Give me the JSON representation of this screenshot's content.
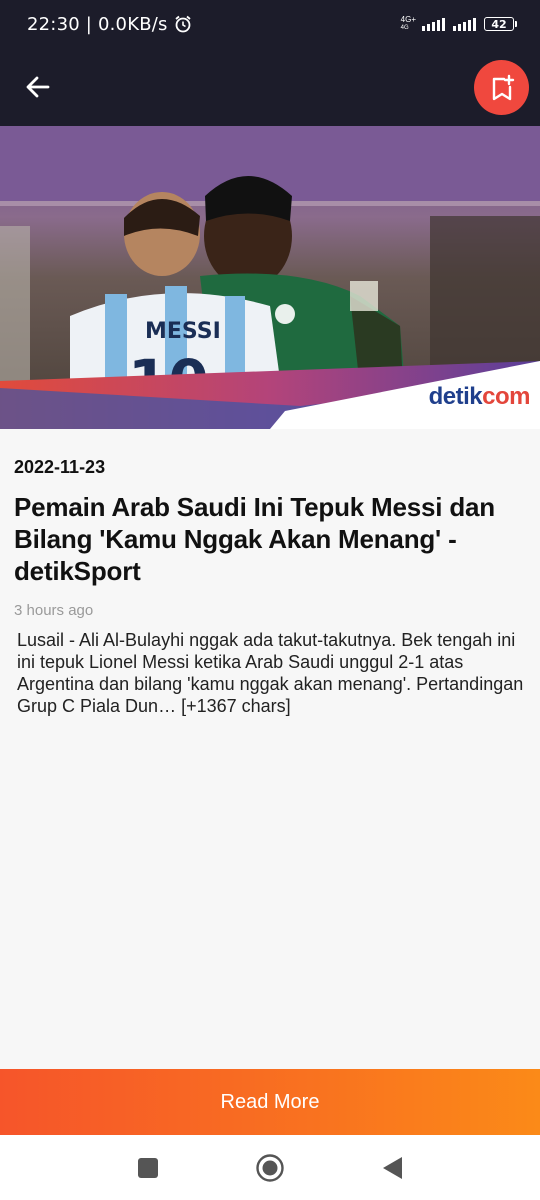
{
  "status_bar": {
    "time": "22:30",
    "speed": "0.0KB/s",
    "network_type_top": "4G+",
    "network_type_bottom": "4G",
    "battery": "42"
  },
  "app_bar": {
    "back_icon": "arrow-left-icon",
    "bookmark_icon": "bookmark-add-icon",
    "bookmark_color": "#f0483e"
  },
  "article": {
    "image_brand_main": "detik",
    "image_brand_accent": "com",
    "image_jersey_name": "MESSI",
    "date": "2022-11-23",
    "title": "Pemain Arab Saudi Ini Tepuk Messi dan Bilang 'Kamu Nggak Akan Menang' - detikSport",
    "time_ago": "3 hours ago",
    "description": "Lusail - Ali Al-Bulayhi nggak ada takut-takutnya. Bek tengah ini ini tepuk Lionel Messi ketika Arab Saudi unggul 2-1 atas Argentina dan bilang 'kamu nggak akan menang'. Pertandingan Grup C Piala Dun… [+1367 chars]"
  },
  "read_more": {
    "label": "Read More",
    "color": "#f9731f"
  },
  "nav_bar": {
    "recents_icon": "square-icon",
    "home_icon": "circle-icon",
    "back_icon": "triangle-back-icon"
  }
}
